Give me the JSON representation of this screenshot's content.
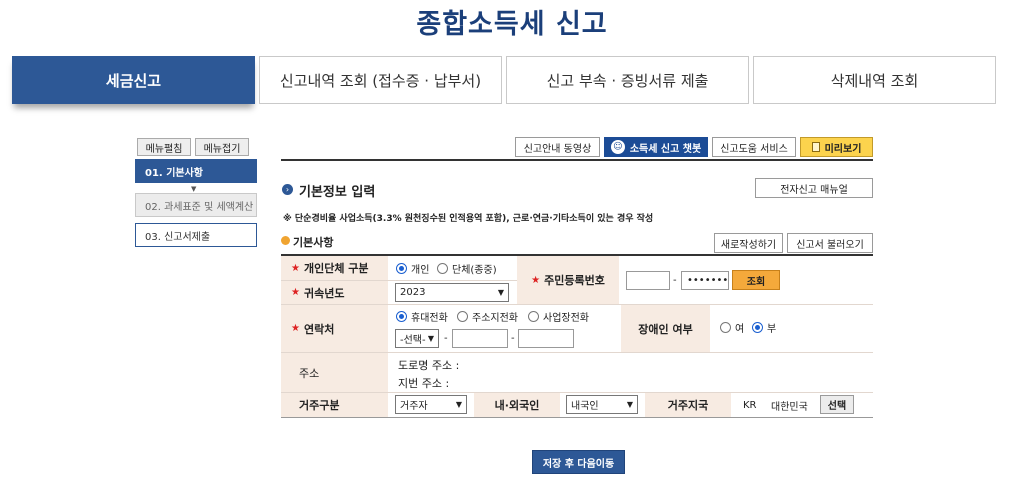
{
  "page_title": "종합소득세 신고",
  "tabs": [
    "세금신고",
    "신고내역 조회 (접수증 · 납부서)",
    "신고 부속 · 증빙서류 제출",
    "삭제내역 조회"
  ],
  "sidebar": {
    "expand": "메뉴펼침",
    "collapse": "메뉴접기",
    "items": [
      "01. 기본사항",
      "02. 과세표준 및 세액계산",
      "03. 신고서제출"
    ]
  },
  "toolbar": {
    "guide_video": "신고안내 동영상",
    "chatbot": "소득세 신고 챗봇",
    "help_service": "신고도움 서비스",
    "preview": "미리보기"
  },
  "section": {
    "title": "기본정보 입력",
    "manual": "전자신고 매뉴얼",
    "notice": "※ 단순경비율 사업소득(3.3% 원천징수된 인적용역 포함), 근로·연금·기타소득이 있는 경우 작성",
    "sub_title": "기본사항",
    "new_button": "새로작성하기",
    "load_button": "신고서 불러오기"
  },
  "form": {
    "type_label": "개인단체 구분",
    "type_individual": "개인",
    "type_group": "단체(종중)",
    "rrn_label": "주민등록번호",
    "rrn_back": "•••••••",
    "lookup": "조회",
    "year_label": "귀속년도",
    "year_value": "2023",
    "contact_label": "연락처",
    "phone_mobile": "휴대전화",
    "phone_home": "주소지전화",
    "phone_work": "사업장전화",
    "phone_select": "-선택-",
    "dash": "-",
    "disabled_label": "장애인 여부",
    "yes": "여",
    "no": "부",
    "address_label": "주소",
    "road_address": "도로명 주소 :",
    "lot_address": "지번 주소 :",
    "residence_label": "거주구분",
    "residence_value": "거주자",
    "nationality_label": "내·외국인",
    "nationality_value": "내국인",
    "country_label": "거주지국",
    "country_code": "KR",
    "country_name": "대한민국",
    "choose": "선택"
  },
  "submit": "저장 후 다음이동",
  "colors": {
    "brand": "#1b3f7a",
    "active_tab": "#2d5896",
    "label_bg": "#f7ebe2",
    "lookup_btn": "#f4a93b"
  }
}
